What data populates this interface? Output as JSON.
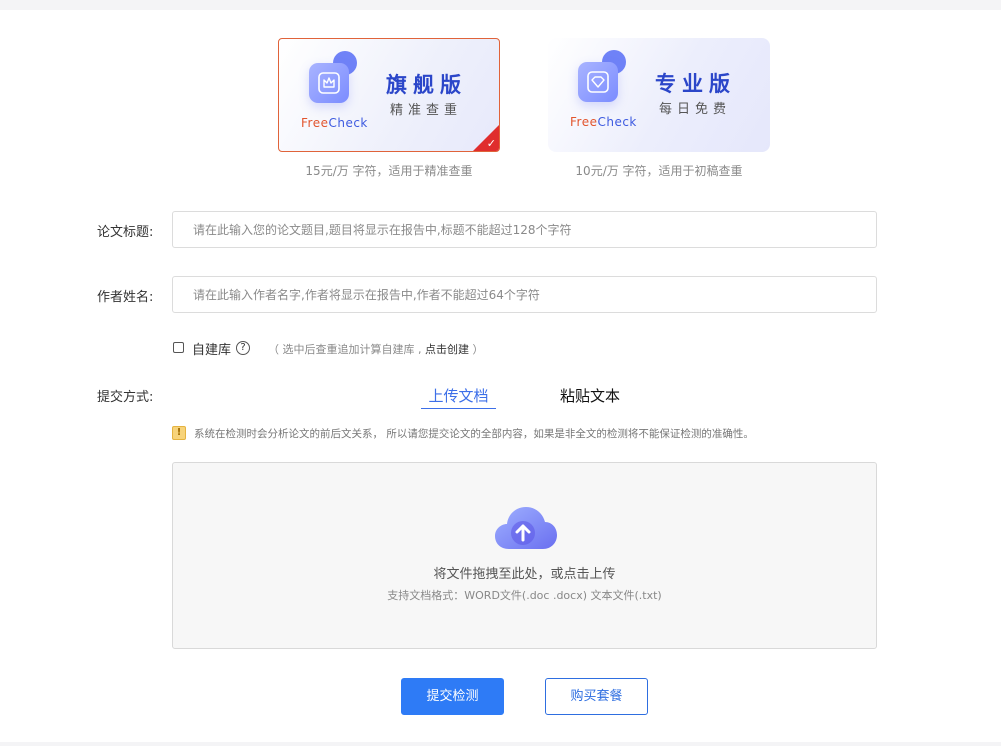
{
  "plans": [
    {
      "name": "旗舰版",
      "subtitle": "精准查重",
      "brand_free": "Free",
      "brand_check": "Check",
      "caption": "15元/万 字符，适用于精准查重",
      "selected": true,
      "corner_mark": "✓"
    },
    {
      "name": "专业版",
      "subtitle": "每日免费",
      "brand_free": "Free",
      "brand_check": "Check",
      "caption": "10元/万 字符，适用于初稿查重",
      "selected": false
    }
  ],
  "form": {
    "title_label": "论文标题:",
    "title_placeholder": "请在此输入您的论文题目,题目将显示在报告中,标题不能超过128个字符",
    "title_value": "",
    "author_label": "作者姓名:",
    "author_placeholder": "请在此输入作者名字,作者将显示在报告中,作者不能超过64个字符",
    "author_value": "",
    "self_library_label": "自建库",
    "self_library_checked": false,
    "help_glyph": "?",
    "hint_prefix": "（ 选中后查重追加计算自建库 , ",
    "hint_link": "点击创建",
    "hint_suffix": " ）",
    "submit_method_label": "提交方式:",
    "tabs": [
      {
        "label": "上传文档",
        "active": true
      },
      {
        "label": "粘贴文本",
        "active": false
      }
    ],
    "warning_glyph": "!",
    "warning_text": "系统在检测时会分析论文的前后文关系， 所以请您提交论文的全部内容，如果是非全文的检测将不能保证检测的准确性。",
    "upload": {
      "main_text": "将文件拖拽至此处，或点击上传",
      "formats_text": "支持文档格式：WORD文件(.doc .docx)    文本文件(.txt)",
      "icon": "cloud-upload-icon"
    }
  },
  "buttons": {
    "submit": "提交检测",
    "buy": "购买套餐"
  },
  "colors": {
    "accent_blue": "#2e7bf6",
    "plan_title_blue": "#2b46c9",
    "selected_border": "#e0633a",
    "corner_red": "#e02d2d",
    "brand_orange": "#e2552e"
  }
}
